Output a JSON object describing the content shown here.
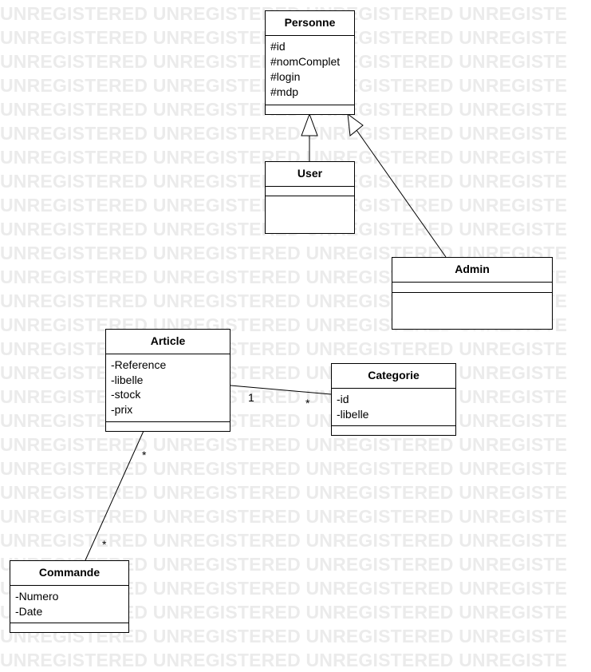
{
  "watermark": {
    "text": "UNREGISTERED UNREGISTERED UNREGISTERED UNREGISTE"
  },
  "classes": {
    "personne": {
      "name": "Personne",
      "attributes": [
        "#id",
        "#nomComplet",
        "#login",
        "#mdp"
      ]
    },
    "user": {
      "name": "User",
      "attributes": []
    },
    "admin": {
      "name": "Admin",
      "attributes": []
    },
    "article": {
      "name": "Article",
      "attributes": [
        "-Reference",
        "-libelle",
        "-stock",
        "-prix"
      ]
    },
    "categorie": {
      "name": "Categorie",
      "attributes": [
        "-id",
        "-libelle"
      ]
    },
    "commande": {
      "name": "Commande",
      "attributes": [
        "-Numero",
        "-Date"
      ]
    }
  },
  "associations": {
    "article_categorie": {
      "source_multiplicity": "1",
      "target_multiplicity": "*"
    },
    "article_commande": {
      "source_multiplicity": "*",
      "target_multiplicity": "*"
    }
  }
}
